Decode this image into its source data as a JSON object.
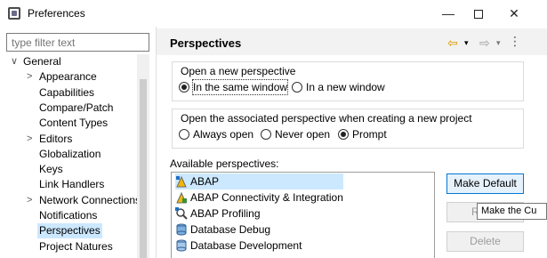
{
  "window": {
    "title": "Preferences",
    "minimize_icon": "minimize-icon",
    "close_glyph": "✕",
    "minimize_glyph": "—"
  },
  "filter": {
    "placeholder": "type filter text"
  },
  "tree": {
    "items": [
      {
        "label": "General",
        "expander": "∨",
        "level": 0
      },
      {
        "label": "Appearance",
        "expander": ">",
        "level": 1
      },
      {
        "label": "Capabilities",
        "expander": "",
        "level": 1
      },
      {
        "label": "Compare/Patch",
        "expander": "",
        "level": 1
      },
      {
        "label": "Content Types",
        "expander": "",
        "level": 1
      },
      {
        "label": "Editors",
        "expander": ">",
        "level": 1
      },
      {
        "label": "Globalization",
        "expander": "",
        "level": 1
      },
      {
        "label": "Keys",
        "expander": "",
        "level": 1
      },
      {
        "label": "Link Handlers",
        "expander": "",
        "level": 1
      },
      {
        "label": "Network Connections",
        "expander": ">",
        "level": 1
      },
      {
        "label": "Notifications",
        "expander": "",
        "level": 1
      },
      {
        "label": "Perspectives",
        "expander": "",
        "level": 1,
        "selected": true
      },
      {
        "label": "Project Natures",
        "expander": "",
        "level": 1
      }
    ]
  },
  "page": {
    "title": "Perspectives",
    "nav": {
      "back": "⇦",
      "forward": "⇨",
      "dropdown": "▾",
      "menu": "⋮"
    }
  },
  "open_perspective": {
    "title": "Open a new perspective",
    "options": [
      {
        "label": "In the same window",
        "checked": true
      },
      {
        "label": "In a new window",
        "checked": false
      }
    ]
  },
  "associated_perspective": {
    "title": "Open the associated perspective when creating a new project",
    "options": [
      {
        "label": "Always open",
        "checked": false
      },
      {
        "label": "Never open",
        "checked": false
      },
      {
        "label": "Prompt",
        "checked": true
      }
    ]
  },
  "available": {
    "label": "Available perspectives:",
    "items": [
      {
        "label": "ABAP",
        "icon": "abap-perspective-icon",
        "selected": true
      },
      {
        "label": "ABAP Connectivity & Integration",
        "icon": "connectivity-icon"
      },
      {
        "label": "ABAP Profiling",
        "icon": "profiling-icon"
      },
      {
        "label": "Database Debug",
        "icon": "database-debug-icon"
      },
      {
        "label": "Database Development",
        "icon": "database-icon"
      }
    ]
  },
  "buttons": {
    "make_default": "Make Default",
    "reset": "R",
    "delete": "Delete"
  },
  "tooltip": {
    "text": "Make the Cu"
  },
  "colors": {
    "selection": "#cce8ff",
    "default_button_border": "#0078d7"
  }
}
